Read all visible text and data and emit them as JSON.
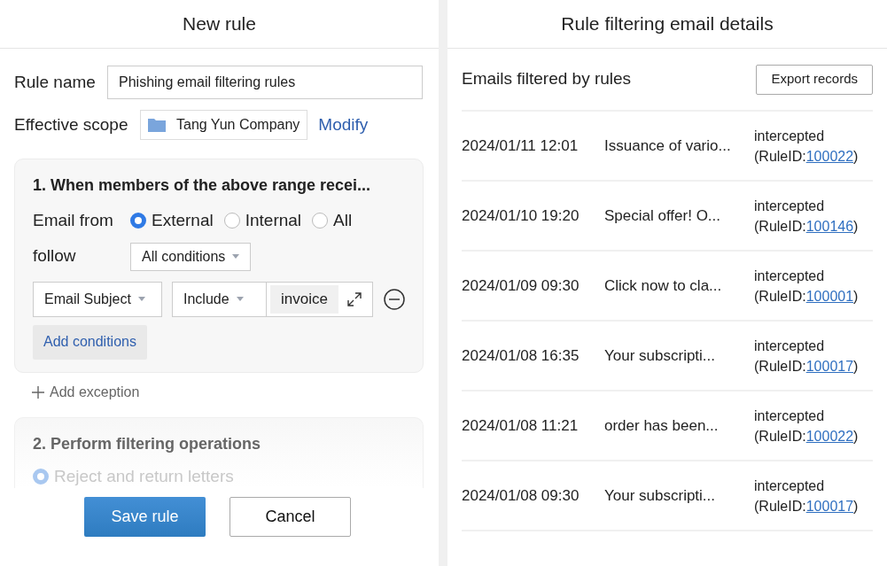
{
  "left_panel": {
    "title": "New rule",
    "rule_name": {
      "label": "Rule name",
      "value": "Phishing email filtering rules"
    },
    "scope": {
      "label": "Effective scope",
      "value": "Tang Yun Company",
      "action": "Modify"
    },
    "condition_card": {
      "title": "1. When members of the above range recei...",
      "email_from": {
        "label": "Email from",
        "options": [
          {
            "label": "External",
            "selected": true
          },
          {
            "label": "Internal",
            "selected": false
          },
          {
            "label": "All",
            "selected": false
          }
        ]
      },
      "follow": {
        "label": "follow",
        "value": "All conditions"
      },
      "condition": {
        "field": "Email Subject",
        "operator": "Include",
        "keyword": "invoice"
      },
      "add_button": "Add conditions"
    },
    "add_exception": "Add exception",
    "action_card": {
      "title": "2. Perform filtering operations",
      "options": [
        {
          "label": "Reject and return letters",
          "selected": true
        }
      ]
    },
    "buttons": [
      {
        "label": "Save rule",
        "kind": "primary"
      },
      {
        "label": "Cancel",
        "kind": "secondary"
      }
    ]
  },
  "right_panel": {
    "title": "Rule filtering email details",
    "subtitle": "Emails filtered by rules",
    "export_button": "Export records",
    "rows": [
      {
        "time": "2024/01/11 12:01",
        "subject": "Issuance of vario...",
        "status": "intercepted",
        "rule_prefix": "(RuleID:",
        "rule_id": "100022",
        "rule_suffix": ")"
      },
      {
        "time": "2024/01/10 19:20",
        "subject": "Special offer! O...",
        "status": "intercepted",
        "rule_prefix": "(RuleID:",
        "rule_id": "100146",
        "rule_suffix": ")"
      },
      {
        "time": "2024/01/09 09:30",
        "subject": "Click now to cla...",
        "status": "intercepted",
        "rule_prefix": "(RuleID:",
        "rule_id": "100001",
        "rule_suffix": ")"
      },
      {
        "time": "2024/01/08 16:35",
        "subject": "Your subscripti...",
        "status": "intercepted",
        "rule_prefix": "(RuleID:",
        "rule_id": "100017",
        "rule_suffix": ")"
      },
      {
        "time": "2024/01/08 11:21",
        "subject": "order has been...",
        "status": "intercepted",
        "rule_prefix": "(RuleID:",
        "rule_id": "100022",
        "rule_suffix": ")"
      },
      {
        "time": "2024/01/08 09:30",
        "subject": "Your subscripti...",
        "status": "intercepted",
        "rule_prefix": "(RuleID:",
        "rule_id": "100017",
        "rule_suffix": ")"
      }
    ]
  }
}
